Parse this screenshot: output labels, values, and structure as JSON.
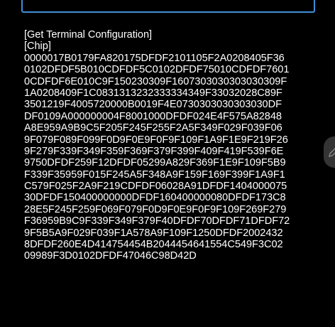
{
  "theme": {
    "background": "#000000",
    "text": "#ffffff",
    "accent": "#3f8fd8"
  },
  "input": {
    "value": ""
  },
  "output": {
    "lines": [
      "[Get Terminal Configuration]",
      "[Chip]",
      "0000017B0179FA820175DFDF2101105F2A0208405F36",
      "0102DFDF5B010CDFDF5C0102DFDF75010CDFDF7601",
      "0CDFDF6E010C9F150230309F1607303030303030309F",
      "1A0208409F1C0831313232333334349F33032028C89F",
      "3501219F4005720000B0019F4E0730303030303030DF",
      "DF0109A000000004F8001000DFDF024E4F575A82848",
      "A8E959A9B9C5F205F245F255F2A5F349F029F039F06",
      "9F079F089F099F0D9F0E9F0F9F109F1A9F1E9F219F26",
      "9F279F339F349F359F369F379F399F409F419F539F6E",
      "9750DFDF259F12DFDF05299A829F369F1E9F109F5B9",
      "F339F35959F015F245A5F348A9F159F169F399F1A9F1",
      "C579F025F2A9F219CDFDF06028A91DFDF1404000075",
      "30DFDF150400000000DFDF160400000080DFDF173C8",
      "28E5F245F259F069F079F0D9F0E9F0F9F109F269F279",
      "F36959B9C9F339F349F379F40DFDF70DFDF71DFDF72",
      "9F5B5A9F029F039F1A578A9F109F1250DFDF2002432",
      "8DFDF260E4D414754454B2044454641554C549F3C02",
      "09989F3D0102DFDF47046C98D42D"
    ]
  }
}
